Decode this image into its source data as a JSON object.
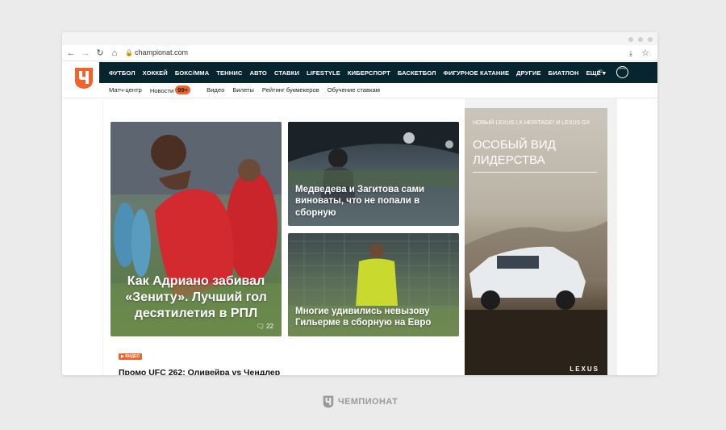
{
  "browser": {
    "url": "championat.com"
  },
  "site": {
    "nav": [
      "ФУТБОЛ",
      "ХОККЕЙ",
      "БОКС/ММА",
      "ТЕННИС",
      "АВТО",
      "СТАВКИ",
      "LIFESTYLE",
      "КИБЕРСПОРТ",
      "БАСКЕТБОЛ",
      "ФИГУРНОЕ КАТАНИЕ",
      "ДРУГИЕ",
      "БИАТЛОН",
      "ЕЩЁ ▾"
    ],
    "subnav": {
      "items": [
        "Матч-центр",
        "Новости",
        "Видео",
        "Билеты",
        "Рейтинг букмекеров",
        "Обучение ставкам"
      ],
      "news_badge": "99+"
    }
  },
  "cards": {
    "main_title": "Как Адриано забивал «Зениту». Лучший гол десятилетия в РПЛ",
    "main_comments": "22",
    "top_right_title": "Медведева и Загитова сами виноваты, что не попали в сборную",
    "bottom_right_title": "Многие удивились невызову Гильерме в сборную на Евро"
  },
  "promo": {
    "badge": "▶ ВИДЕО",
    "title": "Промо UFC 262: Оливейра vs Чендлер"
  },
  "ad": {
    "top_line": "НОВЫЙ LEXUS LX HERITAGE¹ И LEXUS GX",
    "big_text": "ОСОБЫЙ ВИД ЛИДЕРСТВА",
    "brand": "LEXUS"
  },
  "footer": {
    "brand": "ЧЕМПИОНАТ"
  },
  "colors": {
    "accent": "#f2632c",
    "nav_bg": "#07252f"
  }
}
